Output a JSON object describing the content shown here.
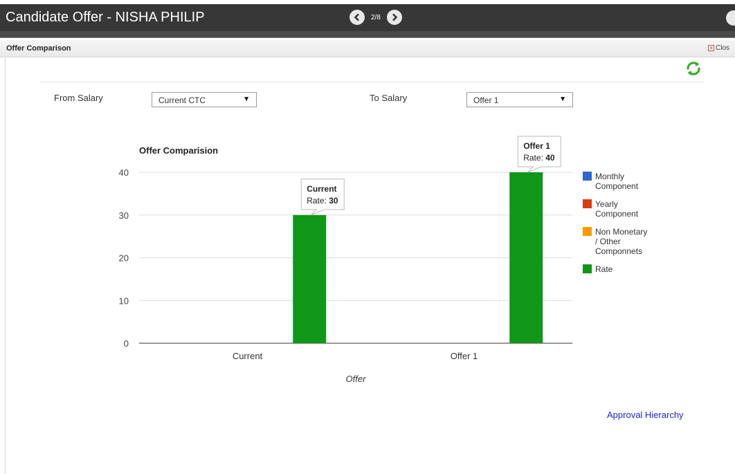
{
  "window": {
    "title": "Candidate Offer - NISHA PHILIP",
    "pager": "2/8"
  },
  "panel": {
    "title": "Offer Comparison",
    "close_label": "Clos"
  },
  "filters": {
    "from_label": "From Salary",
    "from_value": "Current CTC",
    "to_label": "To Salary",
    "to_value": "Offer 1"
  },
  "icons": {
    "prev": "chevron-left-icon",
    "next": "chevron-right-icon",
    "refresh": "refresh-icon",
    "refresh_color": "#3aac2a"
  },
  "links": {
    "approval": "Approval Hierarchy"
  },
  "chart_data": {
    "type": "bar",
    "title": "Offer Comparision",
    "xlabel": "Offer",
    "ylabel": "",
    "categories": [
      "Current",
      "Offer 1"
    ],
    "ylim": [
      0,
      40
    ],
    "yticks": [
      0,
      10,
      20,
      30,
      40
    ],
    "grid": true,
    "legend_position": "right",
    "series": [
      {
        "name": "Monthly Component",
        "color": "#3366cc",
        "values": [
          0,
          0
        ]
      },
      {
        "name": "Yearly Component",
        "color": "#dc3912",
        "values": [
          0,
          0
        ]
      },
      {
        "name": "Non Monetary / Other Componnets",
        "color": "#ff9900",
        "values": [
          0,
          0
        ]
      },
      {
        "name": "Rate",
        "color": "#109618",
        "values": [
          30,
          40
        ]
      }
    ],
    "tooltips": [
      {
        "category": "Current",
        "label": "Current",
        "prefix": "Rate: ",
        "value": "30"
      },
      {
        "category": "Offer 1",
        "label": "Offer 1",
        "prefix": "Rate: ",
        "value": "40"
      }
    ]
  }
}
